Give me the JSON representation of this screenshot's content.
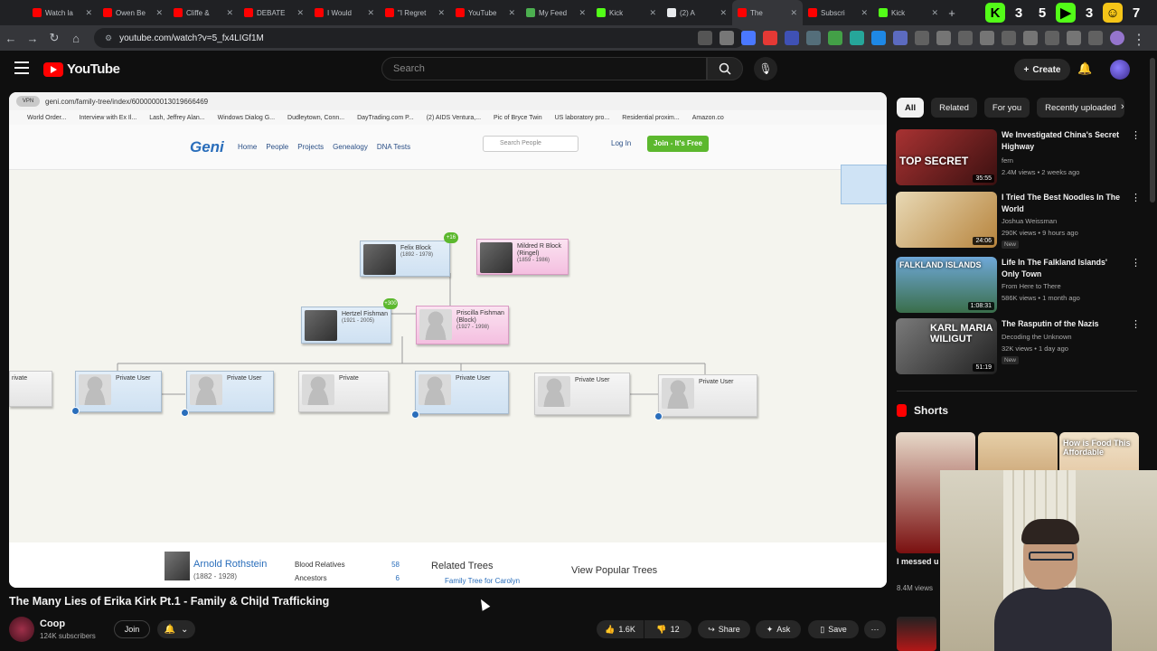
{
  "browser": {
    "tabs": [
      {
        "label": "Watch la",
        "favicon": "youtube"
      },
      {
        "label": "Owen Be",
        "favicon": "youtube"
      },
      {
        "label": "Cliffe &",
        "favicon": "youtube"
      },
      {
        "label": "DEBATE",
        "favicon": "youtube"
      },
      {
        "label": "I Would",
        "favicon": "youtube"
      },
      {
        "label": "\"I Regret",
        "favicon": "youtube"
      },
      {
        "label": "YouTube",
        "favicon": "youtube"
      },
      {
        "label": "My Feed",
        "favicon": "feed"
      },
      {
        "label": "Kick",
        "favicon": "kick"
      },
      {
        "label": "(2) A",
        "favicon": "x"
      },
      {
        "label": "The",
        "favicon": "youtube",
        "active": true
      },
      {
        "label": "Subscri",
        "favicon": "youtube"
      },
      {
        "label": "Kick",
        "favicon": "kick"
      }
    ],
    "new_tab": "+",
    "ext_numbers": [
      "3",
      "5",
      "3",
      "7"
    ],
    "url": "youtube.com/watch?v=5_fx4LIGf1M"
  },
  "youtube": {
    "logo_text": "YouTube",
    "search_placeholder": "Search",
    "create_label": "Create"
  },
  "video_frame": {
    "inner_url": "geni.com/family-tree/index/6000000013019666469",
    "inner_pill": "VPN",
    "bookmarks": [
      "World Order...",
      "Interview with Ex Il...",
      "Lash, Jeffrey Alan...",
      "Windows Dialog G...",
      "Dudleytown, Conn...",
      "DayTrading.com P...",
      "(2) AIDS Ventura,...",
      "Pic of Bryce Twin",
      "US laboratory pro...",
      "Residential proxim...",
      "Amazon.co"
    ],
    "geni": {
      "logo": "Geni",
      "nav": [
        "Home",
        "People",
        "Projects",
        "Genealogy",
        "DNA Tests"
      ],
      "search_placeholder": "Search People",
      "login": "Log In",
      "join": "Join - It's Free"
    },
    "people": [
      {
        "name": "Felix Block",
        "dates": "(1892 - 1978)",
        "badge": "+16"
      },
      {
        "name": "Mildred R Block (Ringel)",
        "dates": "(1859 - 1986)"
      },
      {
        "name": "Hertzel Fishman",
        "dates": "(1921 - 2005)",
        "badge": "+300"
      },
      {
        "name": "Priscilla Fishman (Block)",
        "dates": "(1927 - 1998)"
      },
      {
        "name": "Private User"
      },
      {
        "name": "Private User"
      },
      {
        "name": "Private"
      },
      {
        "name": "Private User"
      },
      {
        "name": "Private User"
      },
      {
        "name": "Private User"
      },
      {
        "name": "rivate"
      }
    ],
    "info": {
      "name": "Arnold Rothstein",
      "dates": "(1882 - 1928)",
      "stats": [
        {
          "label": "Blood Relatives",
          "value": "58"
        },
        {
          "label": "Ancestors",
          "value": "6"
        }
      ],
      "related_title": "Related Trees",
      "related_link": "Family Tree for Carolyn",
      "popular_title": "View Popular Trees"
    }
  },
  "video": {
    "title": "The Many Lies of Erika Kirk Pt.1 - Family & Chi|d Trafficking",
    "channel": "Coop",
    "subscribers": "124K subscribers",
    "join_label": "Join",
    "likes": "1.6K",
    "dislikes": "12",
    "share_label": "Share",
    "ask_label": "Ask",
    "save_label": "Save"
  },
  "sidebar": {
    "chips": [
      "All",
      "Related",
      "For you",
      "Recently uploaded"
    ],
    "recommendations": [
      {
        "title": "We Investigated China's Secret Highway",
        "channel": "fern",
        "meta": "2.4M views • 2 weeks ago",
        "duration": "35:55",
        "thumb_text": "TOP SECRET",
        "new": ""
      },
      {
        "title": "I Tried The Best Noodles In The World",
        "channel": "Joshua Weissman",
        "meta": "290K views • 9 hours ago",
        "duration": "24:06",
        "thumb_text": "",
        "new": "New"
      },
      {
        "title": "Life In The Falkland Islands' Only Town",
        "channel": "From Here to There",
        "meta": "586K views • 1 month ago",
        "duration": "1:08:31",
        "thumb_text": "FALKLAND ISLANDS",
        "new": ""
      },
      {
        "title": "The Rasputin of the Nazis",
        "channel": "Decoding the Unknown",
        "meta": "32K views • 1 day ago",
        "duration": "51:19",
        "thumb_text": "KARL MARIA WILIGUT",
        "new": "New"
      }
    ],
    "shorts_title": "Shorts",
    "short_thumb_text": "How is Food This Affordable",
    "short_title": "I messed u",
    "short_views": "8.4M views"
  },
  "colors": {
    "youtube_red": "#ff0000",
    "geni_green": "#5cb82e",
    "geni_blue": "#2a6ebb"
  }
}
